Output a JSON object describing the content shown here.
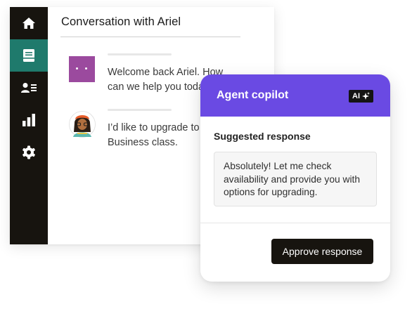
{
  "sidebar": {
    "items": [
      {
        "icon": "home-icon",
        "active": false
      },
      {
        "icon": "inbox-icon",
        "active": true
      },
      {
        "icon": "contacts-icon",
        "active": false
      },
      {
        "icon": "bar-chart-icon",
        "active": false
      },
      {
        "icon": "gear-icon",
        "active": false
      }
    ]
  },
  "conversation": {
    "title": "Conversation with Ariel",
    "messages": [
      {
        "line1": "Welcome back Ariel. How",
        "line2": "can we help you today?"
      },
      {
        "line1": "I’d like to upgrade to",
        "line2": "Business class."
      }
    ]
  },
  "copilot": {
    "title": "Agent copilot",
    "ai_badge": "AI",
    "section_label": "Suggested response",
    "suggestion": "Absolutely! Let me check availability and provide you with options for upgrading.",
    "approve_label": "Approve response"
  },
  "colors": {
    "sidebar_bg": "#17140f",
    "sidebar_active": "#1f7a6c",
    "copilot_header": "#6a4ae3",
    "bot_avatar": "#9b4a9e"
  }
}
